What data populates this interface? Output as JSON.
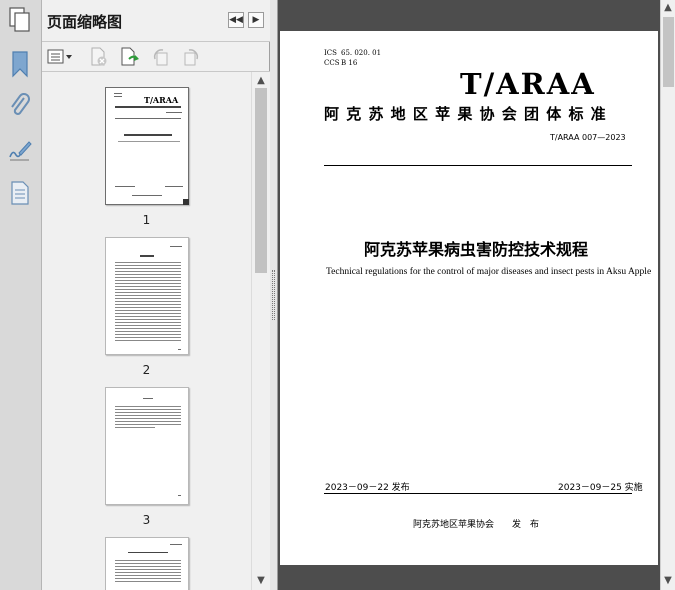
{
  "panel": {
    "title": "页面缩略图",
    "thumbnails": [
      {
        "page": "1"
      },
      {
        "page": "2"
      },
      {
        "page": "3"
      }
    ]
  },
  "rail": {
    "icons": [
      "bookmark-icon",
      "attachment-icon",
      "signature-icon",
      "document-icon"
    ]
  },
  "document": {
    "ics_label": "ICS",
    "ics_value": "65. 020. 01",
    "ccs_label": "CCS",
    "ccs_value": "B 16",
    "logo": "T/ARAA",
    "org_standard": "阿 克 苏 地 区 苹 果 协 会 团 体 标 准",
    "std_number": "T/ARAA 007—2023",
    "title_cn": "阿克苏苹果病虫害防控技术规程",
    "title_en": "Technical regulations for the control of major diseases and insect pests in Aksu Apple",
    "issue_date": "2023－09－22 发布",
    "implement_date": "2023－09－25 实施",
    "publisher": "阿克苏地区苹果协会　　发　布"
  },
  "colors": {
    "rail_bg": "#d9d9d9",
    "panel_bg": "#f0f0f0",
    "doc_bg": "#4d4d4d",
    "page_bg": "#ffffff",
    "icon_blue": "#4f7fb0"
  }
}
